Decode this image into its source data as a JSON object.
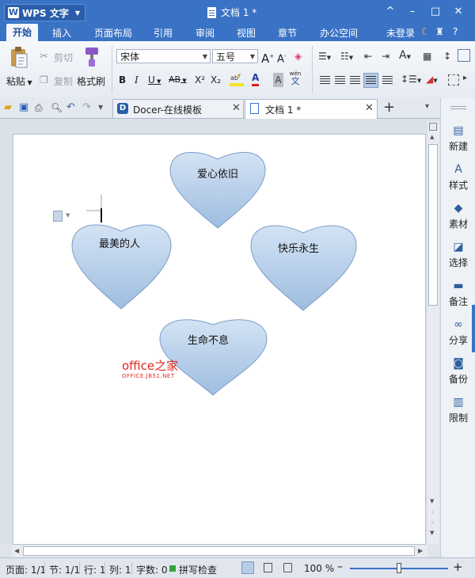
{
  "titlebar": {
    "app_name": "WPS 文字",
    "app_logo_letter": "W",
    "document_title": "文档 1 *",
    "window_buttons": [
      "^",
      "–",
      "□",
      "✕"
    ]
  },
  "menubar": {
    "items": [
      "开始",
      "插入",
      "页面布局",
      "引用",
      "审阅",
      "视图",
      "章节",
      "办公空间"
    ],
    "login_label": "未登录",
    "help_label": "?"
  },
  "ribbon": {
    "paste_label": "粘贴",
    "cut_label": "剪切",
    "copy_label": "复制",
    "format_painter_label": "格式刷",
    "font_name": "宋体",
    "font_size": "五号",
    "bold": "B",
    "italic": "I",
    "underline": "U",
    "strikethrough": "AB",
    "superscript": "X²",
    "subscript": "X₂",
    "font_color": "A",
    "char_shading": "A",
    "phonetic_top": "wén",
    "phonetic_bottom": "文",
    "grow_font": "A",
    "shrink_font": "A",
    "text_effect": "A"
  },
  "tabs": [
    {
      "label": "Docer-在线模板",
      "close": "✕"
    },
    {
      "label": "文档 1 *",
      "close": "✕"
    }
  ],
  "new_tab_label": "+",
  "right_panel": {
    "items": [
      "新建",
      "样式",
      "素材",
      "选择",
      "备注",
      "分享",
      "备份",
      "限制"
    ]
  },
  "document": {
    "hearts": [
      "爱心依旧",
      "最美的人",
      "快乐永生",
      "生命不息"
    ],
    "heart_fill_top": "#d3e3f4",
    "heart_fill_bottom": "#9fbde0",
    "heart_stroke": "#7a9dc8",
    "watermark_main": "office之家",
    "watermark_sub": "OFFICE.JB51.NET",
    "watermark_color": "#e0261c"
  },
  "statusbar": {
    "page": "页面: 1/1",
    "section": "节: 1/1",
    "line": "行: 1",
    "column": "列: 1",
    "word_count": "字数: 0",
    "spell_check": "拼写检查",
    "zoom": "100 %",
    "zoom_out": "–",
    "zoom_in": "+",
    "zoom_level": 0.5
  }
}
